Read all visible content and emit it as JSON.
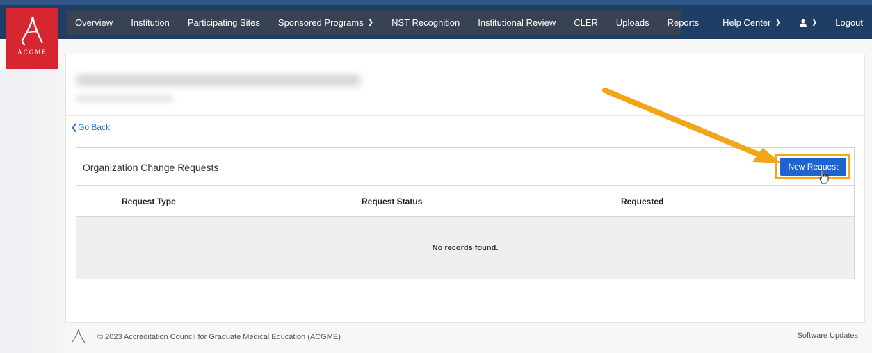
{
  "logo": {
    "text": "ACGME"
  },
  "nav": {
    "items": [
      {
        "label": "Overview"
      },
      {
        "label": "Institution"
      },
      {
        "label": "Participating Sites"
      },
      {
        "label": "Sponsored Programs",
        "dropdown": true
      },
      {
        "label": "NST Recognition"
      },
      {
        "label": "Institutional Review"
      },
      {
        "label": "CLER"
      },
      {
        "label": "Uploads"
      },
      {
        "label": "Reports"
      }
    ],
    "help_center": "Help Center",
    "logout": "Logout"
  },
  "page": {
    "go_back": "Go Back"
  },
  "panel": {
    "title": "Organization Change Requests",
    "new_request_label": "New Request",
    "columns": [
      "Request Type",
      "Request Status",
      "Requested"
    ],
    "empty_message": "No records found."
  },
  "footer": {
    "copyright": "© 2023 Accreditation Council for Graduate Medical Education (ACGME)",
    "software_updates": "Software Updates"
  },
  "colors": {
    "header_bg": "#1f3e66",
    "nav_bg": "#384252",
    "logo_red": "#d6262f",
    "button_blue": "#1b64d1",
    "highlight_orange": "#f5a619",
    "link_blue": "#2a6fc9"
  }
}
